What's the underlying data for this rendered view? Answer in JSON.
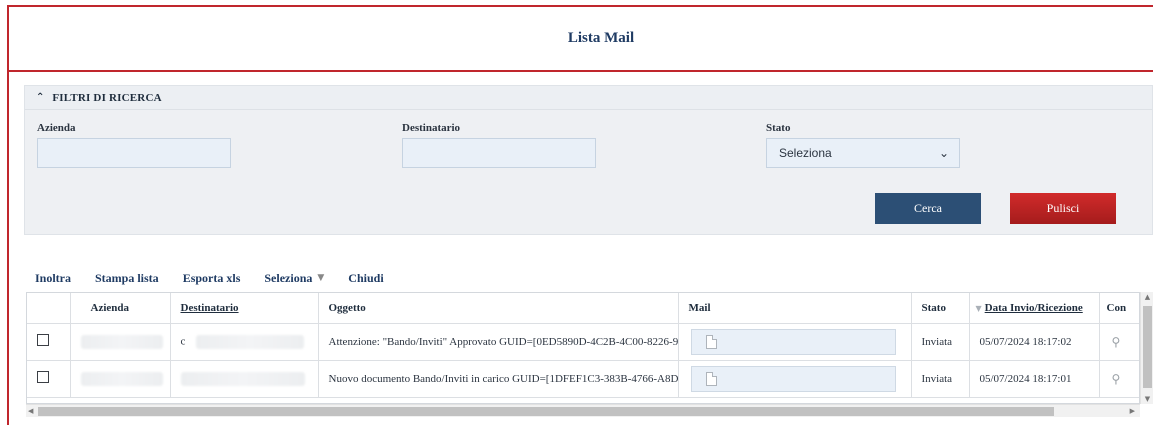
{
  "header": {
    "title": "Lista Mail"
  },
  "filters": {
    "section_label": "FILTRI DI RICERCA",
    "azienda_label": "Azienda",
    "azienda_value": "",
    "destinatario_label": "Destinatario",
    "destinatario_value": "",
    "stato_label": "Stato",
    "stato_selected": "Seleziona",
    "cerca_label": "Cerca",
    "pulisci_label": "Pulisci"
  },
  "toolbar": {
    "inoltra": "Inoltra",
    "stampa": "Stampa lista",
    "esporta": "Esporta xls",
    "seleziona": "Seleziona",
    "chiudi": "Chiudi"
  },
  "table": {
    "columns": [
      "Azienda",
      "Destinatario",
      "Oggetto",
      "Mail",
      "Stato",
      "Data Invio/Ricezione",
      "Con"
    ],
    "rows": [
      {
        "destinatario_prefix": "c",
        "oggetto": "Attenzione: \"Bando/Inviti\" Approvato GUID=[0ED5890D-4C2B-4C00-8226-9…",
        "stato": "Inviata",
        "data": "05/07/2024 18:17:02"
      },
      {
        "destinatario_prefix": "",
        "oggetto": "Nuovo documento Bando/Inviti in carico GUID=[1DFEF1C3-383B-4766-A8D…",
        "stato": "Inviata",
        "data": "05/07/2024 18:17:01"
      }
    ]
  },
  "icons": {
    "collapse": "chevron-up-icon",
    "dropdown": "chevron-down-icon",
    "document": "document-icon",
    "view": "magnifier-icon",
    "sort": "sort-desc-icon"
  },
  "colors": {
    "accent_red": "#c0262d",
    "primary_blue": "#2c4f75",
    "danger_red": "#b82222"
  }
}
